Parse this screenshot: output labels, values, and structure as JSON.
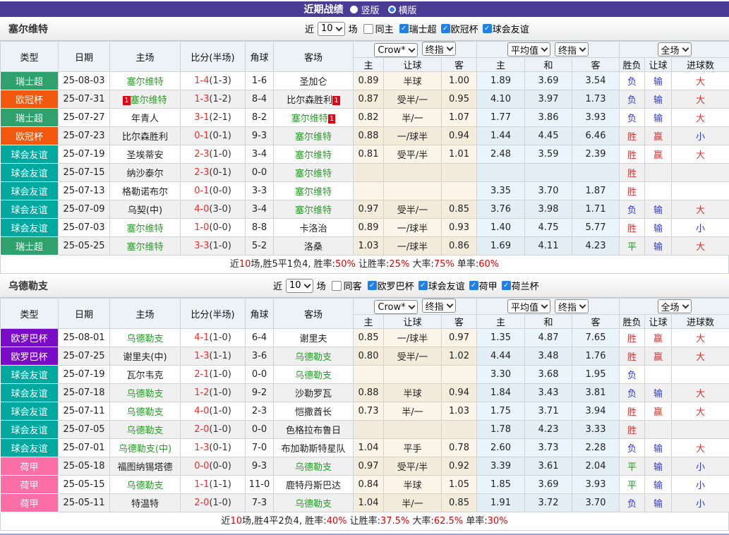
{
  "title_bar": {
    "title": "近期战绩",
    "layout_options": [
      {
        "label": "竖版",
        "selected": false
      },
      {
        "label": "横版",
        "selected": true
      }
    ]
  },
  "table_header": {
    "left_columns": [
      "类型",
      "日期",
      "主场",
      "比分(半场)",
      "角球",
      "客场"
    ],
    "odds_dropdowns": [
      "Crow*",
      "终指"
    ],
    "odds_columns": [
      "主",
      "让球",
      "客"
    ],
    "avg_dropdowns": [
      "平均值",
      "终指"
    ],
    "avg_columns": [
      "主",
      "和",
      "客"
    ],
    "result_dropdown": "全场",
    "result_columns": [
      "胜负",
      "让球",
      "进球数"
    ]
  },
  "league_colors": {
    "瑞士超": "#2fa16c",
    "欧冠杯": "#f2590f",
    "球会友谊": "#00a9a0",
    "欧罗巴杯": "#7a0cc8",
    "荷甲": "#fb6fa6"
  },
  "sections": [
    {
      "team": "塞尔维特",
      "filter": {
        "near": "近",
        "count": "10",
        "unit": "场",
        "same": {
          "label": "同主",
          "checked": false
        },
        "leagues": [
          {
            "label": "瑞士超",
            "checked": true
          },
          {
            "label": "欧冠杯",
            "checked": true
          },
          {
            "label": "球会友谊",
            "checked": true
          }
        ]
      },
      "rows": [
        {
          "league": "瑞士超",
          "date": "25-08-03",
          "home": {
            "name": "塞尔维特",
            "focus": true
          },
          "score": "1-4",
          "half": "(1-3)",
          "corners": "1-6",
          "away": {
            "name": "圣加仑"
          },
          "odds": [
            "0.89",
            "半球",
            "1.00"
          ],
          "avg": [
            "1.89",
            "3.69",
            "3.54"
          ],
          "results": [
            {
              "text": "负",
              "color": "blue"
            },
            {
              "text": "输",
              "color": "blue"
            },
            {
              "text": "大",
              "color": "red"
            }
          ]
        },
        {
          "league": "欧冠杯",
          "date": "25-07-31",
          "home": {
            "name": "塞尔维特",
            "focus": true,
            "card_before": "1"
          },
          "score": "1-3",
          "half": "(1-2)",
          "corners": "8-4",
          "away": {
            "name": "比尔森胜利",
            "card_after": "1"
          },
          "odds": [
            "0.87",
            "受半/一",
            "0.95"
          ],
          "avg": [
            "4.10",
            "3.97",
            "1.73"
          ],
          "results": [
            {
              "text": "负",
              "color": "blue"
            },
            {
              "text": "输",
              "color": "blue"
            },
            {
              "text": "大",
              "color": "red"
            }
          ]
        },
        {
          "league": "瑞士超",
          "date": "25-07-27",
          "home": {
            "name": "年青人"
          },
          "score": "3-1",
          "half": "(2-1)",
          "corners": "8-2",
          "away": {
            "name": "塞尔维特",
            "focus": true,
            "card_after": "1"
          },
          "odds": [
            "0.82",
            "半/一",
            "1.07"
          ],
          "avg": [
            "1.77",
            "3.86",
            "3.93"
          ],
          "results": [
            {
              "text": "负",
              "color": "blue"
            },
            {
              "text": "输",
              "color": "blue"
            },
            {
              "text": "大",
              "color": "red"
            }
          ]
        },
        {
          "league": "欧冠杯",
          "date": "25-07-23",
          "home": {
            "name": "比尔森胜利"
          },
          "score": "0-1",
          "half": "(0-1)",
          "corners": "9-3",
          "away": {
            "name": "塞尔维特",
            "focus": true
          },
          "odds": [
            "0.88",
            "一/球半",
            "0.94"
          ],
          "avg": [
            "1.44",
            "4.45",
            "6.46"
          ],
          "results": [
            {
              "text": "胜",
              "color": "red"
            },
            {
              "text": "赢",
              "color": "red"
            },
            {
              "text": "小",
              "color": "blue"
            }
          ]
        },
        {
          "league": "球会友谊",
          "date": "25-07-19",
          "home": {
            "name": "圣埃蒂安"
          },
          "score": "2-3",
          "half": "(1-0)",
          "corners": "3-4",
          "away": {
            "name": "塞尔维特",
            "focus": true
          },
          "odds": [
            "0.81",
            "受平/半",
            "1.01"
          ],
          "avg": [
            "2.48",
            "3.59",
            "2.39"
          ],
          "results": [
            {
              "text": "胜",
              "color": "red"
            },
            {
              "text": "赢",
              "color": "red"
            },
            {
              "text": "大",
              "color": "red"
            }
          ]
        },
        {
          "league": "球会友谊",
          "date": "25-07-15",
          "home": {
            "name": "纳沙泰尔"
          },
          "score": "2-3",
          "half": "(0-1)",
          "corners": "0-0",
          "away": {
            "name": "塞尔维特",
            "focus": true
          },
          "odds": [
            "",
            "",
            ""
          ],
          "avg": [
            "",
            "",
            ""
          ],
          "results": [
            {
              "text": "胜",
              "color": "red"
            },
            null,
            null
          ]
        },
        {
          "league": "球会友谊",
          "date": "25-07-13",
          "home": {
            "name": "格勒诺布尔"
          },
          "score": "0-1",
          "half": "(0-0)",
          "corners": "3-3",
          "away": {
            "name": "塞尔维特",
            "focus": true
          },
          "odds": [
            "",
            "",
            ""
          ],
          "avg": [
            "3.35",
            "3.70",
            "1.87"
          ],
          "results": [
            {
              "text": "胜",
              "color": "red"
            },
            null,
            null
          ]
        },
        {
          "league": "球会友谊",
          "date": "25-07-09",
          "home": {
            "name": "乌契(中)"
          },
          "score": "4-0",
          "half": "(3-0)",
          "corners": "3-4",
          "away": {
            "name": "塞尔维特",
            "focus": true
          },
          "odds": [
            "0.97",
            "受半/一",
            "0.85"
          ],
          "avg": [
            "3.76",
            "3.98",
            "1.71"
          ],
          "results": [
            {
              "text": "负",
              "color": "blue"
            },
            {
              "text": "输",
              "color": "blue"
            },
            {
              "text": "大",
              "color": "red"
            }
          ]
        },
        {
          "league": "球会友谊",
          "date": "25-07-03",
          "home": {
            "name": "塞尔维特",
            "focus": true
          },
          "score": "1-0",
          "half": "(0-0)",
          "corners": "8-8",
          "away": {
            "name": "卡洛治"
          },
          "odds": [
            "0.89",
            "一/球半",
            "0.93"
          ],
          "avg": [
            "1.40",
            "4.75",
            "5.77"
          ],
          "results": [
            {
              "text": "胜",
              "color": "red"
            },
            {
              "text": "输",
              "color": "blue"
            },
            {
              "text": "小",
              "color": "blue"
            }
          ]
        },
        {
          "league": "瑞士超",
          "date": "25-05-25",
          "home": {
            "name": "塞尔维特",
            "focus": true
          },
          "score": "3-3",
          "half": "(1-0)",
          "corners": "5-2",
          "away": {
            "name": "洛桑"
          },
          "odds": [
            "1.03",
            "一/球半",
            "0.86"
          ],
          "avg": [
            "1.69",
            "4.11",
            "4.23"
          ],
          "results": [
            {
              "text": "平",
              "color": "green"
            },
            {
              "text": "输",
              "color": "blue"
            },
            {
              "text": "大",
              "color": "red"
            }
          ]
        }
      ],
      "summary": [
        {
          "text": "近",
          "red": false
        },
        {
          "text": "10",
          "red": true
        },
        {
          "text": "场,胜5平1负4, 胜率:",
          "red": false
        },
        {
          "text": "50%",
          "red": true
        },
        {
          "text": " 让胜率:",
          "red": false
        },
        {
          "text": "25%",
          "red": true
        },
        {
          "text": " 大率:",
          "red": false
        },
        {
          "text": "75%",
          "red": true
        },
        {
          "text": " 单率:",
          "red": false
        },
        {
          "text": "60%",
          "red": true
        }
      ]
    },
    {
      "team": "乌德勒支",
      "filter": {
        "near": "近",
        "count": "10",
        "unit": "场",
        "same": {
          "label": "同客",
          "checked": false
        },
        "leagues": [
          {
            "label": "欧罗巴杯",
            "checked": true
          },
          {
            "label": "球会友谊",
            "checked": true
          },
          {
            "label": "荷甲",
            "checked": true
          },
          {
            "label": "荷兰杯",
            "checked": true
          }
        ]
      },
      "rows": [
        {
          "league": "欧罗巴杯",
          "date": "25-08-01",
          "home": {
            "name": "乌德勒支",
            "focus": true
          },
          "score": "4-1",
          "half": "(1-0)",
          "corners": "6-4",
          "away": {
            "name": "谢里夫"
          },
          "odds": [
            "0.85",
            "一/球半",
            "0.97"
          ],
          "avg": [
            "1.35",
            "4.87",
            "7.65"
          ],
          "results": [
            {
              "text": "胜",
              "color": "red"
            },
            {
              "text": "赢",
              "color": "red"
            },
            {
              "text": "大",
              "color": "red"
            }
          ]
        },
        {
          "league": "欧罗巴杯",
          "date": "25-07-25",
          "home": {
            "name": "谢里夫(中)"
          },
          "score": "1-3",
          "half": "(1-1)",
          "corners": "3-6",
          "away": {
            "name": "乌德勒支",
            "focus": true
          },
          "odds": [
            "0.80",
            "受半/一",
            "1.02"
          ],
          "avg": [
            "4.44",
            "3.48",
            "1.76"
          ],
          "results": [
            {
              "text": "胜",
              "color": "red"
            },
            {
              "text": "赢",
              "color": "red"
            },
            {
              "text": "大",
              "color": "red"
            }
          ]
        },
        {
          "league": "球会友谊",
          "date": "25-07-19",
          "home": {
            "name": "瓦尔韦克"
          },
          "score": "2-1",
          "half": "(1-0)",
          "corners": "0-0",
          "away": {
            "name": "乌德勒支",
            "focus": true
          },
          "odds": [
            "",
            "",
            ""
          ],
          "avg": [
            "3.30",
            "3.68",
            "1.95"
          ],
          "results": [
            {
              "text": "负",
              "color": "blue"
            },
            null,
            null
          ]
        },
        {
          "league": "球会友谊",
          "date": "25-07-18",
          "home": {
            "name": "乌德勒支",
            "focus": true
          },
          "score": "1-2",
          "half": "(1-0)",
          "corners": "9-2",
          "away": {
            "name": "沙勒罗瓦"
          },
          "odds": [
            "0.88",
            "半球",
            "0.94"
          ],
          "avg": [
            "1.84",
            "3.43",
            "3.81"
          ],
          "results": [
            {
              "text": "负",
              "color": "blue"
            },
            {
              "text": "输",
              "color": "blue"
            },
            {
              "text": "大",
              "color": "red"
            }
          ]
        },
        {
          "league": "球会友谊",
          "date": "25-07-11",
          "home": {
            "name": "乌德勒支",
            "focus": true
          },
          "score": "4-0",
          "half": "(1-0)",
          "corners": "2-3",
          "away": {
            "name": "恺撒酋长"
          },
          "odds": [
            "0.73",
            "半/一",
            "1.03"
          ],
          "avg": [
            "1.75",
            "3.71",
            "3.94"
          ],
          "results": [
            {
              "text": "胜",
              "color": "red"
            },
            {
              "text": "赢",
              "color": "red"
            },
            {
              "text": "大",
              "color": "red"
            }
          ]
        },
        {
          "league": "球会友谊",
          "date": "25-07-05",
          "home": {
            "name": "乌德勒支",
            "focus": true
          },
          "score": "2-0",
          "half": "(1-0)",
          "corners": "0-0",
          "away": {
            "name": "色格拉布鲁日"
          },
          "odds": [
            "",
            "",
            ""
          ],
          "avg": [
            "1.78",
            "4.23",
            "3.33"
          ],
          "results": [
            {
              "text": "胜",
              "color": "red"
            },
            null,
            null
          ]
        },
        {
          "league": "球会友谊",
          "date": "25-07-01",
          "home": {
            "name": "乌德勒支(中)",
            "focus": true
          },
          "score": "1-3",
          "half": "(0-1)",
          "corners": "7-0",
          "away": {
            "name": "布加勒斯特星队"
          },
          "odds": [
            "1.04",
            "平手",
            "0.78"
          ],
          "avg": [
            "2.60",
            "3.73",
            "2.28"
          ],
          "results": [
            {
              "text": "负",
              "color": "blue"
            },
            {
              "text": "输",
              "color": "blue"
            },
            {
              "text": "大",
              "color": "red"
            }
          ]
        },
        {
          "league": "荷甲",
          "date": "25-05-18",
          "home": {
            "name": "福图纳锡塔德"
          },
          "score": "0-0",
          "half": "(0-0)",
          "corners": "9-3",
          "away": {
            "name": "乌德勒支",
            "focus": true
          },
          "odds": [
            "0.97",
            "受平/半",
            "0.92"
          ],
          "avg": [
            "3.39",
            "3.61",
            "2.04"
          ],
          "results": [
            {
              "text": "平",
              "color": "green"
            },
            {
              "text": "输",
              "color": "blue"
            },
            {
              "text": "小",
              "color": "blue"
            }
          ]
        },
        {
          "league": "荷甲",
          "date": "25-05-15",
          "home": {
            "name": "乌德勒支",
            "focus": true
          },
          "score": "1-1",
          "half": "(1-1)",
          "corners": "11-0",
          "away": {
            "name": "鹿特丹斯巴达"
          },
          "odds": [
            "0.84",
            "半球",
            "1.05"
          ],
          "avg": [
            "1.85",
            "3.69",
            "3.93"
          ],
          "results": [
            {
              "text": "平",
              "color": "green"
            },
            {
              "text": "输",
              "color": "blue"
            },
            {
              "text": "小",
              "color": "blue"
            }
          ]
        },
        {
          "league": "荷甲",
          "date": "25-05-11",
          "home": {
            "name": "特温特"
          },
          "score": "2-0",
          "half": "(1-0)",
          "corners": "7-3",
          "away": {
            "name": "乌德勒支",
            "focus": true
          },
          "odds": [
            "1.04",
            "半/一",
            "0.85"
          ],
          "avg": [
            "1.91",
            "3.72",
            "3.70"
          ],
          "results": [
            {
              "text": "负",
              "color": "blue"
            },
            {
              "text": "输",
              "color": "blue"
            },
            {
              "text": "小",
              "color": "blue"
            }
          ]
        }
      ],
      "summary": [
        {
          "text": "近",
          "red": false
        },
        {
          "text": "10",
          "red": true
        },
        {
          "text": "场,胜4平2负4, 胜率:",
          "red": false
        },
        {
          "text": "40%",
          "red": true
        },
        {
          "text": " 让胜率:",
          "red": false
        },
        {
          "text": "37.5%",
          "red": true
        },
        {
          "text": " 大率:",
          "red": false
        },
        {
          "text": "62.5%",
          "red": true
        },
        {
          "text": " 单率:",
          "red": false
        },
        {
          "text": "30%",
          "red": true
        }
      ]
    }
  ]
}
